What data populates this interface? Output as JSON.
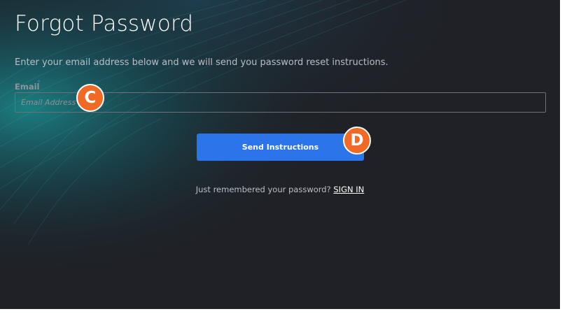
{
  "page": {
    "title": "Forgot Password",
    "subtitle": "Enter your email address below and we will send you password reset instructions."
  },
  "form": {
    "email_label": "Email",
    "required_marker": "*",
    "email_value": "",
    "email_placeholder": "Email Address",
    "submit_label": "Send Instructions"
  },
  "footer": {
    "prompt": "Just remembered your password?",
    "signin_label": "SIGN IN"
  },
  "annotations": {
    "callout_c": "C",
    "callout_d": "D"
  },
  "colors": {
    "background": "#1f2126",
    "accent_blue": "#2b74ea",
    "callout_orange": "#f06a25",
    "wave_teal": "#1aa3a0"
  }
}
